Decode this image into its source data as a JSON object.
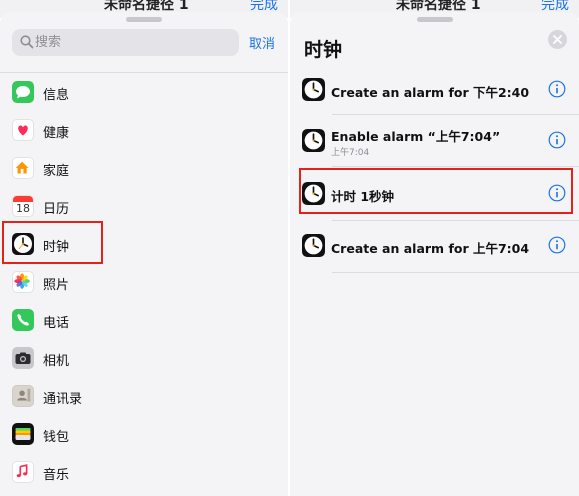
{
  "left": {
    "behind_title": "未命名捷径 1",
    "behind_done": "完成",
    "search": {
      "placeholder": "搜索",
      "value": ""
    },
    "cancel_label": "取消",
    "apps": [
      {
        "label": "信息",
        "icon": "messages-icon"
      },
      {
        "label": "健康",
        "icon": "health-icon"
      },
      {
        "label": "家庭",
        "icon": "home-icon"
      },
      {
        "label": "日历",
        "icon": "calendar-icon",
        "icon_text": "18"
      },
      {
        "label": "时钟",
        "icon": "clock-icon",
        "highlighted": true
      },
      {
        "label": "照片",
        "icon": "photos-icon"
      },
      {
        "label": "电话",
        "icon": "phone-icon"
      },
      {
        "label": "相机",
        "icon": "camera-icon"
      },
      {
        "label": "通讯录",
        "icon": "contacts-icon"
      },
      {
        "label": "钱包",
        "icon": "wallet-icon"
      },
      {
        "label": "音乐",
        "icon": "music-icon"
      }
    ]
  },
  "right": {
    "behind_title": "未命名捷径 1",
    "behind_done": "完成",
    "title": "时钟",
    "actions": [
      {
        "title": "Create an alarm for 下午2:40",
        "subtitle": ""
      },
      {
        "title": "Enable alarm “上午7:04”",
        "subtitle": "上午7:04"
      },
      {
        "title": "计时 1秒钟",
        "subtitle": "",
        "highlighted": true
      },
      {
        "title": "Create an alarm for 上午7:04",
        "subtitle": ""
      }
    ]
  },
  "colors": {
    "accent": "#1a73e8",
    "highlight": "#e2231a"
  }
}
